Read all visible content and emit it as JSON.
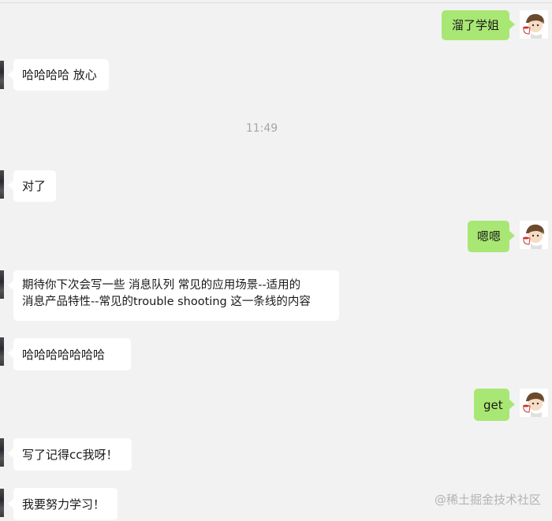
{
  "messages": [
    {
      "side": "out",
      "text": "溜了学姐"
    },
    {
      "side": "in",
      "text": "哈哈哈哈 放心"
    },
    {
      "side": "in",
      "text": "对了"
    },
    {
      "side": "out",
      "text": "嗯嗯"
    },
    {
      "side": "in",
      "line1": "期待你下次会写一些 消息队列  常见的应用场景--适用的",
      "line2": "消息产品特性--常见的trouble shooting 这一条线的内容"
    },
    {
      "side": "in",
      "text": "哈哈哈哈哈哈哈"
    },
    {
      "side": "out",
      "text": "get"
    },
    {
      "side": "in",
      "text": "写了记得cc我呀！"
    },
    {
      "side": "in",
      "text": "我要努力学习！"
    }
  ],
  "timestamp": "11:49",
  "watermark": "@稀土掘金技术社区",
  "icons": {
    "self_avatar": "cartoon-avatar-icon",
    "contact_avatar": "contact-avatar-icon"
  },
  "colors": {
    "background": "#f2f2f2",
    "outgoing_bubble": "#a9e774",
    "incoming_bubble": "#ffffff",
    "timestamp": "#a6a6a6"
  }
}
